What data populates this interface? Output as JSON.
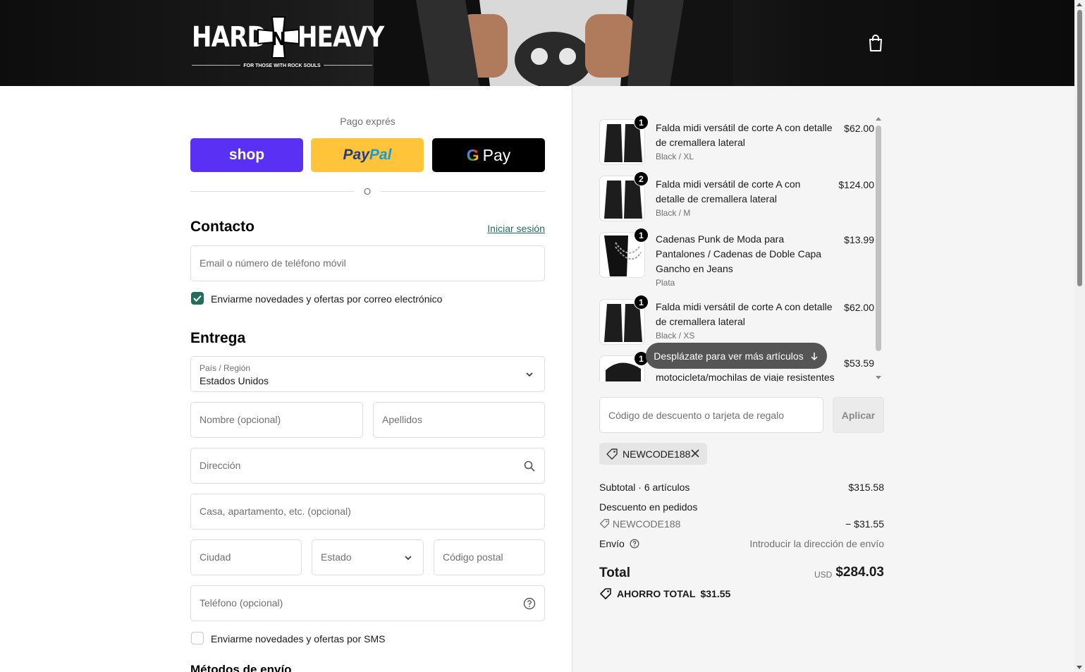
{
  "brand": {
    "logo_text_left": "HARD",
    "logo_text_right": "HEAVY",
    "tagline": "FOR THOSE WITH ROCK SOULS"
  },
  "express": {
    "label": "Pago exprés",
    "shop_label": "shop",
    "paypal_label_1": "Pay",
    "paypal_label_2": "Pal",
    "gpay_g": "G",
    "gpay_label": "Pay",
    "or_label": "O"
  },
  "contact": {
    "title": "Contacto",
    "login_link": "Iniciar sesión",
    "email_placeholder": "Email o número de teléfono móvil",
    "newsletter_label": "Enviarme novedades y ofertas por correo electrónico",
    "newsletter_checked": true
  },
  "delivery": {
    "title": "Entrega",
    "country_label": "País / Región",
    "country_value": "Estados Unidos",
    "first_name_placeholder": "Nombre (opcional)",
    "last_name_placeholder": "Apellidos",
    "address_placeholder": "Dirección",
    "apartment_placeholder": "Casa, apartamento, etc. (opcional)",
    "city_placeholder": "Ciudad",
    "state_placeholder": "Estado",
    "zip_placeholder": "Código postal",
    "phone_placeholder": "Teléfono (opcional)",
    "sms_label": "Enviarme novedades y ofertas por SMS",
    "sms_checked": false,
    "shipping_methods_title": "Métodos de envío"
  },
  "cart": {
    "items": [
      {
        "qty": "1",
        "title": "Falda midi versátil de corte A con detalle de cremallera lateral",
        "variant": "Black / XL",
        "price": "$62.00"
      },
      {
        "qty": "2",
        "title": "Falda midi versátil de corte A con detalle de cremallera lateral",
        "variant": "Black / M",
        "price": "$124.00"
      },
      {
        "qty": "1",
        "title": "Cadenas Punk de Moda para Pantalones / Cadenas de Doble Capa Gancho en Jeans",
        "variant": "Plata",
        "price": "$13.99"
      },
      {
        "qty": "1",
        "title": "Falda midi versátil de corte A con detalle de cremallera lateral",
        "variant": "Black / XS",
        "price": "$62.00"
      },
      {
        "qty": "1",
        "title": "motocicleta/mochilas de viaje resistentes",
        "variant": "",
        "price": "$53.59"
      }
    ],
    "scroll_hint": "Desplázate para ver más artículos"
  },
  "discount": {
    "placeholder": "Código de descuento o tarjeta de regalo",
    "apply_label": "Aplicar",
    "applied_code": "NEWCODE188"
  },
  "summary": {
    "subtotal_label": "Subtotal · 6 artículos",
    "subtotal_value": "$315.58",
    "order_discount_label": "Descuento en pedidos",
    "discount_code": "NEWCODE188",
    "discount_value": "− $31.55",
    "shipping_label": "Envío",
    "shipping_value": "Introducir la dirección de envío",
    "total_label": "Total",
    "currency": "USD",
    "total_value": "$284.03",
    "savings_label": "AHORRO TOTAL",
    "savings_value": "$31.55"
  },
  "colors": {
    "shop_purple": "#5a31f4",
    "paypal_yellow": "#ffc439",
    "accent_green": "#1f6f5c"
  }
}
